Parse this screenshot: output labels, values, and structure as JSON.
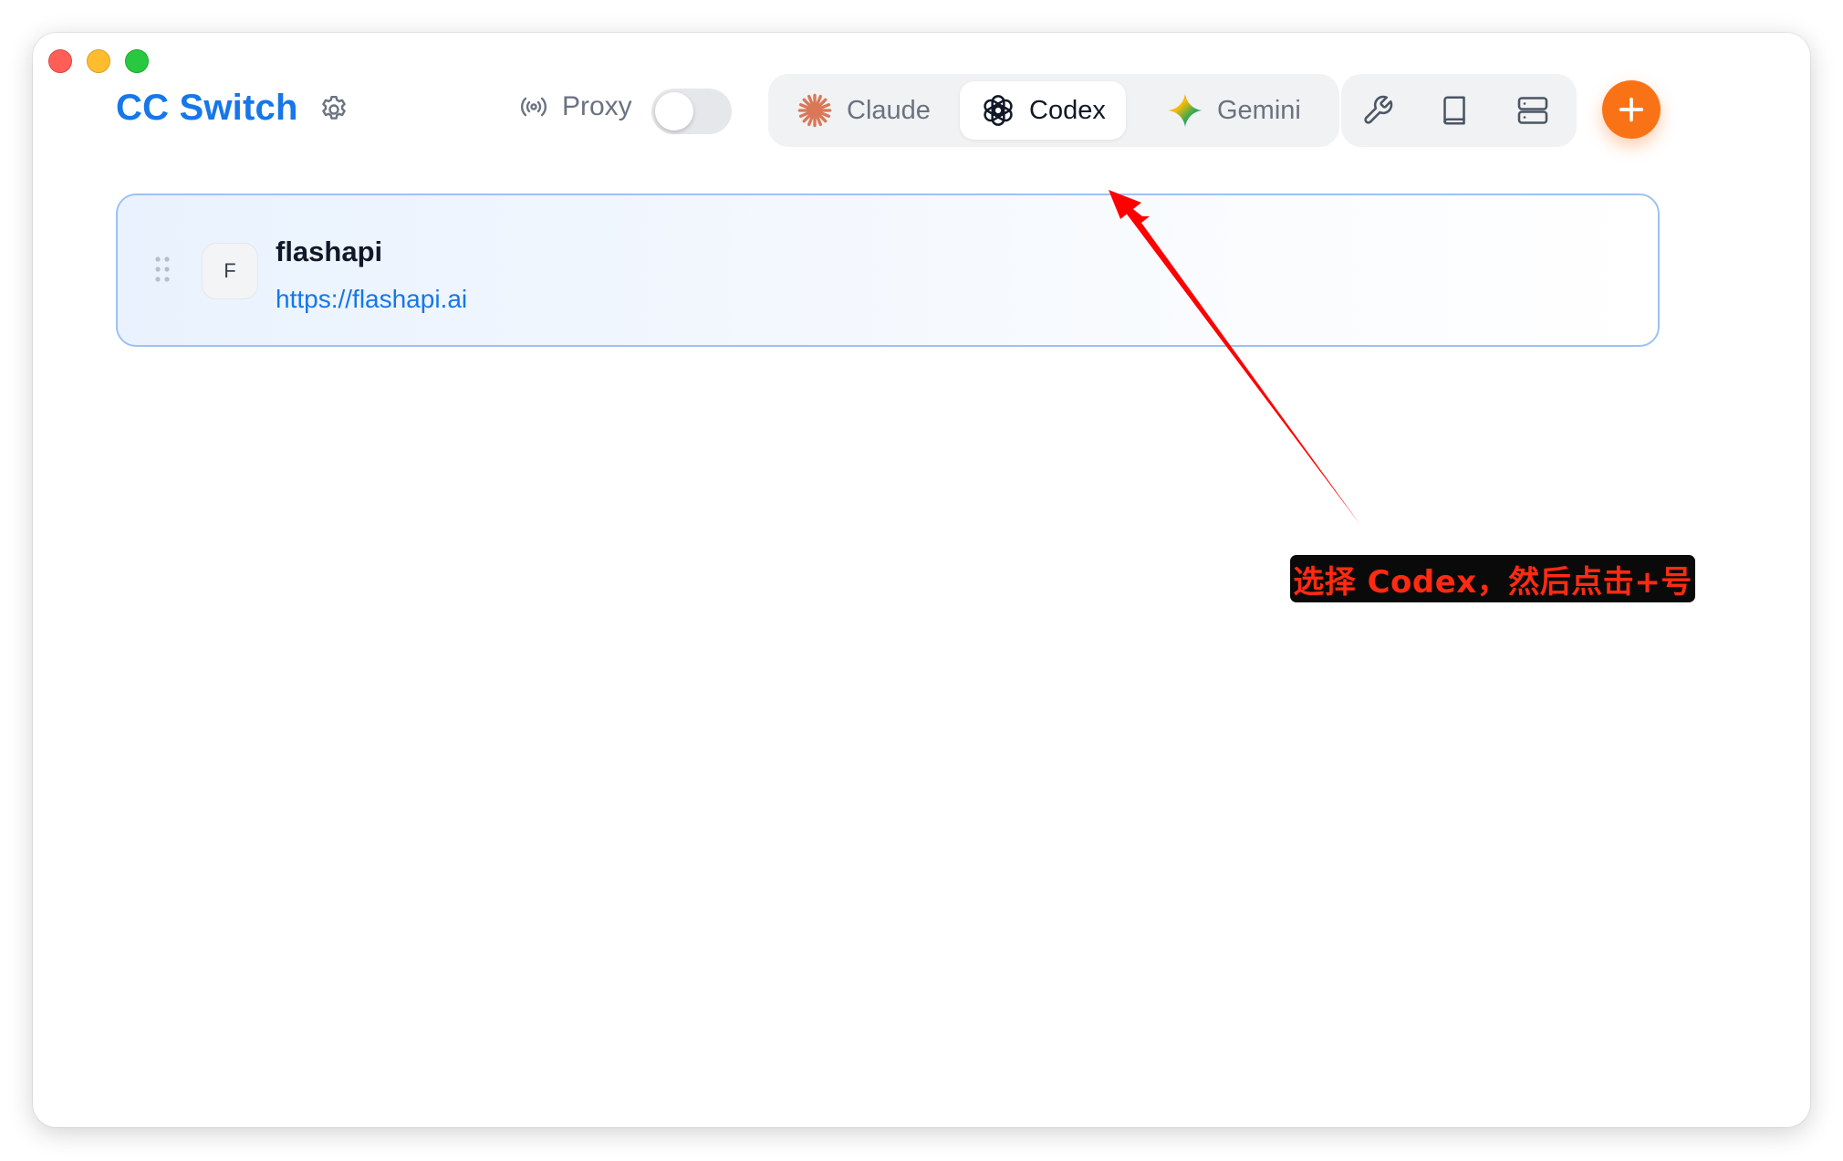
{
  "app": {
    "title": "CC Switch"
  },
  "proxy": {
    "label": "Proxy",
    "enabled": false
  },
  "apps": {
    "items": [
      {
        "label": "Claude",
        "icon": "claude-sunburst-icon"
      },
      {
        "label": "Codex",
        "icon": "openai-knot-icon"
      },
      {
        "label": "Gemini",
        "icon": "gemini-sparkle-icon"
      }
    ],
    "selected": "Codex"
  },
  "toolbar": {
    "icons": [
      "wrench-icon",
      "book-icon",
      "server-icon"
    ]
  },
  "add_button": {
    "icon": "plus-icon"
  },
  "providers": [
    {
      "avatar_letter": "F",
      "name": "flashapi",
      "url": "https://flashapi.ai"
    }
  ],
  "annotation": {
    "text": "选择 Codex，然后点击+号",
    "color": "#ff2a12"
  },
  "colors": {
    "accent": "#1677e8",
    "add_button": "#f97316",
    "card_border": "#9cc2f2"
  }
}
